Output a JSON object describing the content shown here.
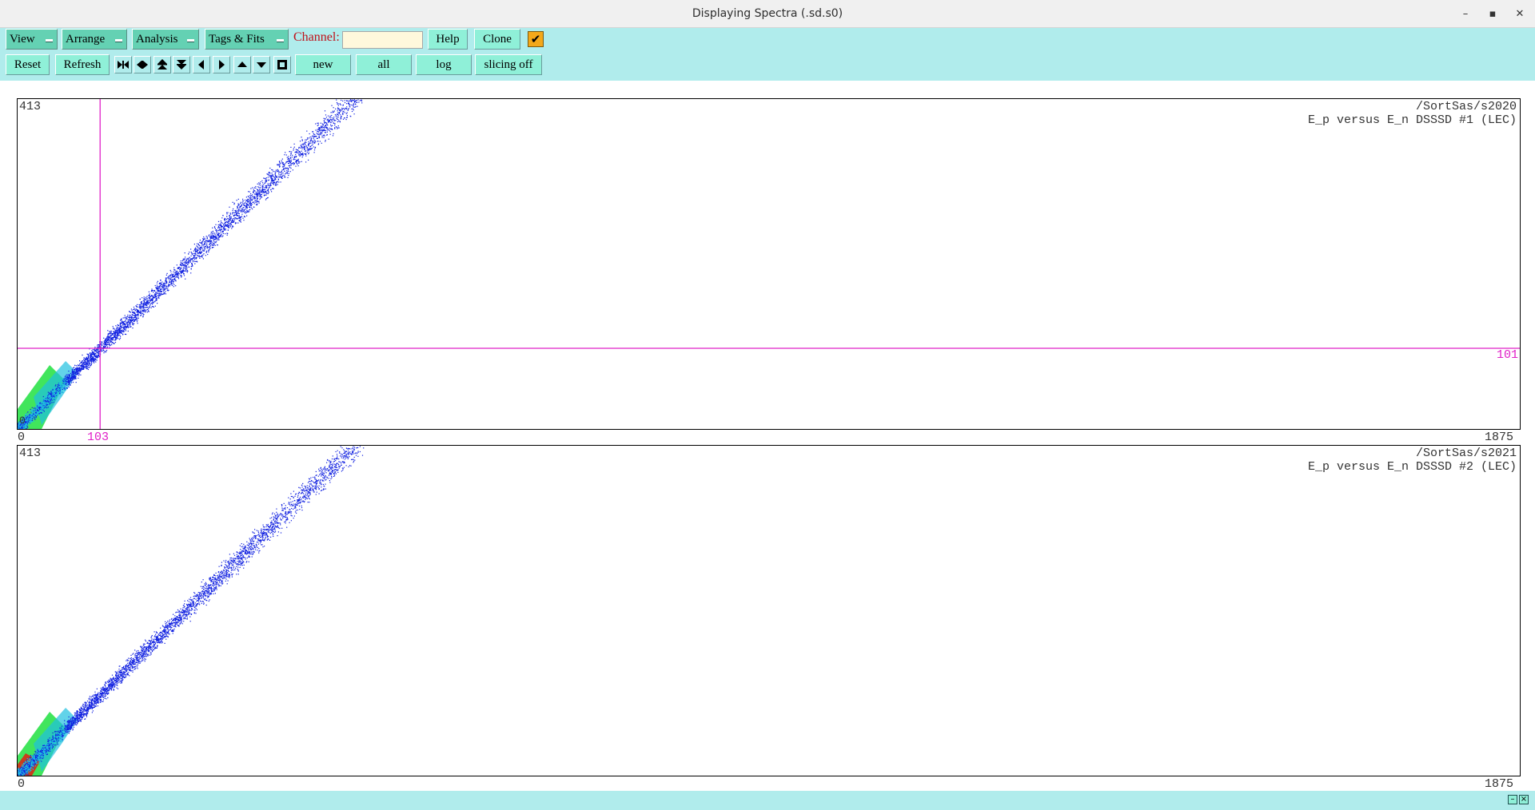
{
  "window": {
    "title": "Displaying Spectra (.sd.s0)",
    "minimize_glyph": "–",
    "maximize_glyph": "▪",
    "close_glyph": "✕"
  },
  "menus": {
    "view": "View",
    "arrange": "Arrange",
    "analysis": "Analysis",
    "tags_fits": "Tags & Fits"
  },
  "channel": {
    "label": "Channel:",
    "value": ""
  },
  "buttons": {
    "help": "Help",
    "clone": "Clone",
    "reset": "Reset",
    "refresh": "Refresh",
    "new": "new",
    "all": "all",
    "log": "log",
    "slicing": "slicing off"
  },
  "checkbox": {
    "checked": true,
    "glyph": "✔"
  },
  "nav_icons": [
    "expand-horizontal-icon",
    "shrink-horizontal-icon",
    "expand-up-icon",
    "shrink-down-icon",
    "step-left-icon",
    "step-right-icon",
    "step-up-icon",
    "step-down-icon",
    "fit-square-icon"
  ],
  "plots": [
    {
      "path": "/SortSas/s2020",
      "subtitle": "E_p versus E_n DSSSD #1 (LEC)",
      "y_max_label": "413",
      "y_min_label": "0",
      "x_min_label": "0",
      "x_max_label": "1875",
      "cursor_x_label": "103",
      "cursor_y_label": "101",
      "x_range": [
        0,
        1875
      ],
      "y_range": [
        0,
        413
      ],
      "cursor": {
        "x": 103,
        "y": 101
      }
    },
    {
      "path": "/SortSas/s2021",
      "subtitle": "E_p versus E_n DSSSD #2 (LEC)",
      "y_max_label": "413",
      "x_min_label": "0",
      "x_max_label": "1875",
      "x_range": [
        0,
        1875
      ],
      "y_range": [
        0,
        413
      ]
    }
  ],
  "colors": {
    "toolbar_bg": "#b0ecec",
    "menu_button": "#64d1b3",
    "button": "#8ff0d8",
    "cursor": "#e020c8",
    "scatter_low": "#1020e0",
    "scatter_mid": "#20c0e0",
    "scatter_high": "#20e040",
    "scatter_peak": "#e02010"
  }
}
